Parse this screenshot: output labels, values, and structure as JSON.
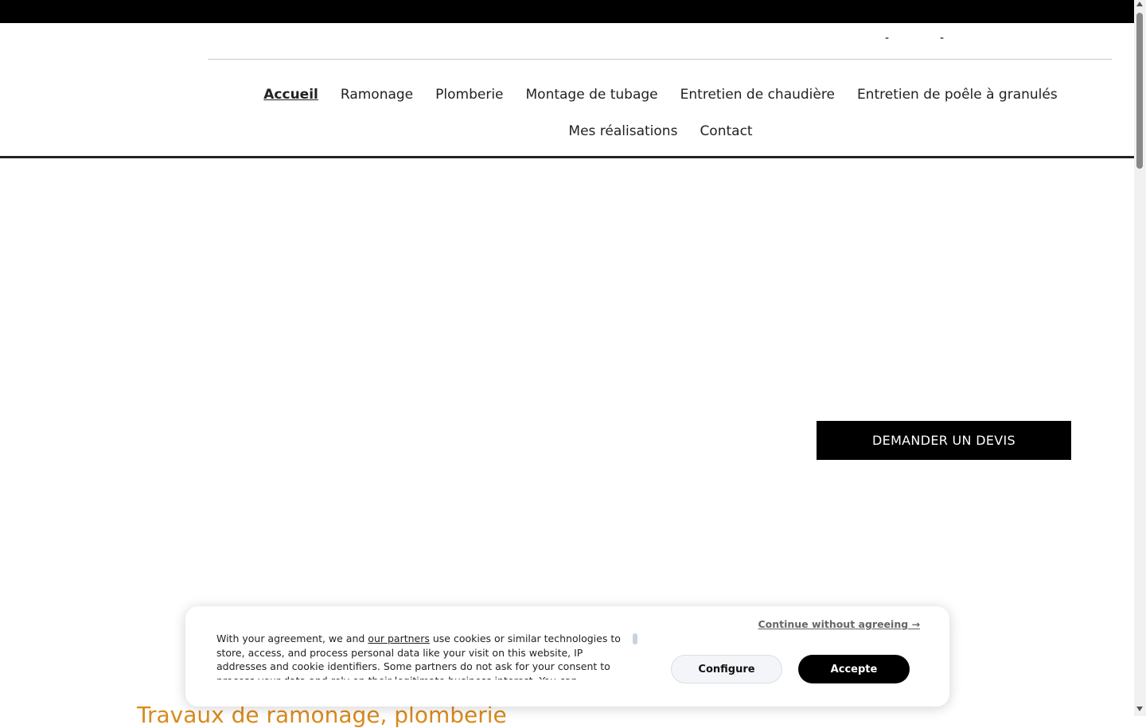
{
  "header": {
    "separators": [
      "-",
      "-"
    ]
  },
  "nav": {
    "items": [
      {
        "label": "Accueil",
        "active": true
      },
      {
        "label": "Ramonage"
      },
      {
        "label": "Plomberie"
      },
      {
        "label": "Montage de tubage"
      },
      {
        "label": "Entretien de chaudière"
      },
      {
        "label": "Entretien de poêle à granulés"
      },
      {
        "label": "Mes réalisations"
      },
      {
        "label": "Contact"
      }
    ]
  },
  "hero": {
    "cta_label": "DEMANDER UN DEVIS"
  },
  "section": {
    "title": "Travaux de ramonage, plomberie"
  },
  "cookie": {
    "text_before_link": "With your agreement, we and ",
    "link_label": "our partners",
    "text_after_link": " use cookies or similar technologies to store, access, and process personal data like your visit on this website, IP addresses and cookie identifiers. Some partners do not ask for your consent to process your data and rely on their legitimate business interest. You can",
    "continue_label": "Continue without agreeing →",
    "configure_label": "Configure",
    "accept_label": "Accepte"
  },
  "colors": {
    "topbar": "#000000",
    "accent_orange": "#d98a1c",
    "cta_bg": "#000000"
  }
}
